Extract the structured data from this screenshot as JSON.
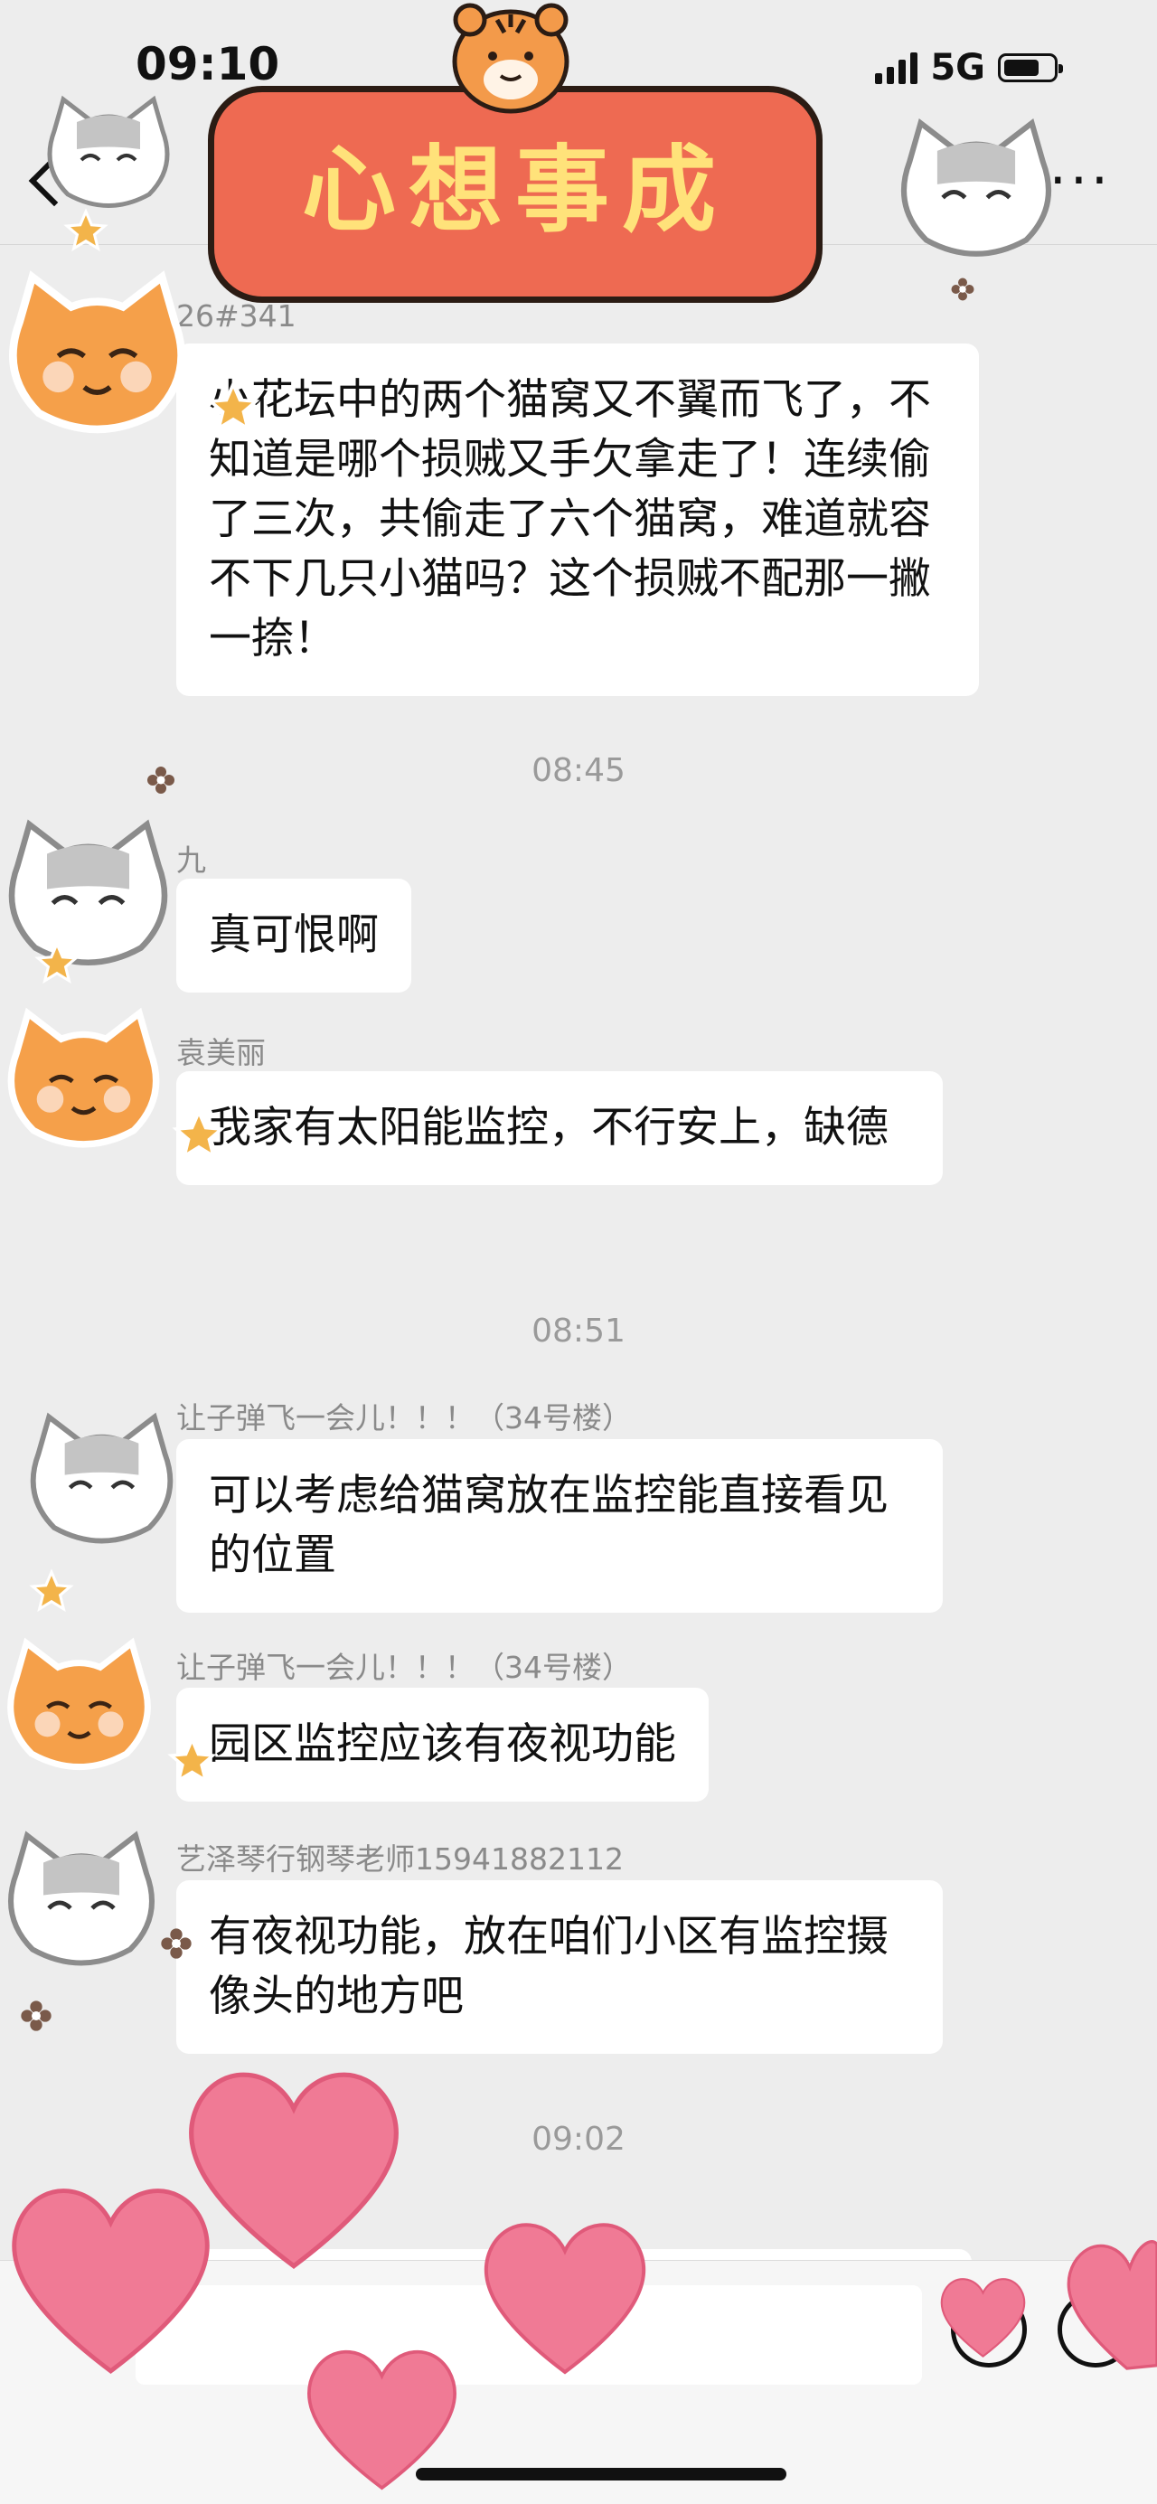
{
  "status_bar": {
    "time": "09:10",
    "network": "5G"
  },
  "header": {
    "title": ""
  },
  "banner": {
    "text": "心想事成"
  },
  "messages": [
    {
      "sender": "26#341",
      "text": "小花坛中的两个猫窝又不翼而飞了，不知道是哪个损贼又手欠拿走了！连续偷了三次，共偷走了六个猫窝，难道就容不下几只小猫吗？这个损贼不配那一撇一捺！"
    },
    {
      "sender": "九",
      "text": "真可恨啊"
    },
    {
      "sender": "袁美丽",
      "text": "我家有太阳能监控，不行安上，缺德"
    },
    {
      "sender": "让子弹飞一会儿！！！（34号楼）",
      "text": "可以考虑给猫窝放在监控能直接看见的位置"
    },
    {
      "sender": "让子弹飞一会儿！！！（34号楼）",
      "text": "园区监控应该有夜视功能"
    },
    {
      "sender": "艺泽琴行钢琴老师15941882112",
      "text": "有夜视功能，放在咱们小区有监控摄像头的地方吧"
    }
  ],
  "timestamps": [
    "08:45",
    "08:51",
    "09:02"
  ],
  "icons": {
    "back": "back-chevron-icon",
    "more": "more-options-icon",
    "emoji": "emoji-icon",
    "plus": "plus-icon"
  },
  "colors": {
    "background": "#ededed",
    "bubble": "#ffffff",
    "banner": "#ee6a52",
    "banner_text": "#ffe27a",
    "heart": "#f07a95"
  }
}
